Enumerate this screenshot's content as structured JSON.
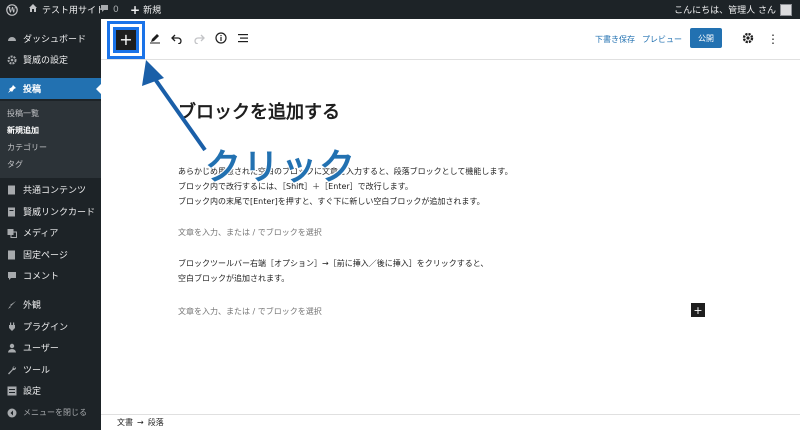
{
  "adminbar": {
    "site_name": "テスト用サイト",
    "comments_count": "0",
    "new_label": "新規",
    "greeting": "こんにちは、管理人 さん"
  },
  "sidebar": {
    "items": [
      {
        "label": "ダッシュボード",
        "icon": "dashboard-icon"
      },
      {
        "label": "賢威の設定",
        "icon": "gear-icon"
      },
      {
        "label": "投稿",
        "icon": "pin-icon"
      },
      {
        "label": "共通コンテンツ",
        "icon": "document-icon"
      },
      {
        "label": "賢威リンクカード",
        "icon": "card-icon"
      },
      {
        "label": "メディア",
        "icon": "media-icon"
      },
      {
        "label": "固定ページ",
        "icon": "page-icon"
      },
      {
        "label": "コメント",
        "icon": "comment-icon"
      },
      {
        "label": "外観",
        "icon": "brush-icon"
      },
      {
        "label": "プラグイン",
        "icon": "plugin-icon"
      },
      {
        "label": "ユーザー",
        "icon": "user-icon"
      },
      {
        "label": "ツール",
        "icon": "wrench-icon"
      },
      {
        "label": "設定",
        "icon": "settings-icon"
      }
    ],
    "submenu": [
      "投稿一覧",
      "新規追加",
      "カテゴリー",
      "タグ"
    ],
    "collapse_label": "メニューを閉じる"
  },
  "toolbar": {
    "save_draft": "下書き保存",
    "preview": "プレビュー",
    "publish": "公開"
  },
  "content": {
    "title": "ブロックを追加する",
    "para1": [
      "あらかじめ用意された空白のブロックに文章を入力すると、段落ブロックとして機能します。",
      "ブロック内で改行するには、［Shift］＋［Enter］で改行します。",
      "ブロック内の末尾で[Enter]を押すと、すぐ下に新しい空白ブロックが追加されます。"
    ],
    "placeholder": "文章を入力、または / でブロックを選択",
    "para2": [
      "ブロックツールバー右端［オプション］→［前に挿入／後に挿入］をクリックすると、",
      "空白ブロックが追加されます。"
    ]
  },
  "annotation": {
    "text": "クリック",
    "color": "#2271b1"
  },
  "footer": {
    "breadcrumb": [
      "文書",
      "段落"
    ],
    "separator": "→"
  },
  "colors": {
    "admin_dark": "#1d2327",
    "accent": "#2271b1",
    "highlight": "#1a73e8"
  }
}
